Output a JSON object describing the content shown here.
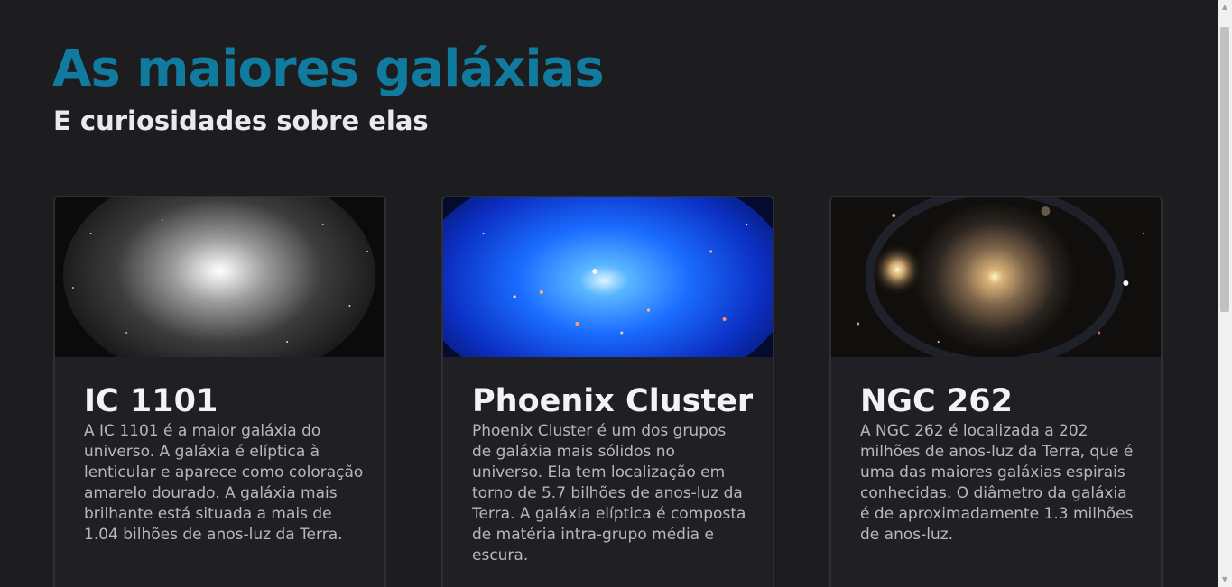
{
  "header": {
    "title": "As maiores galáxias",
    "subtitle": "E curiosidades sobre elas"
  },
  "cards": [
    {
      "title": "IC 1101",
      "text": "A IC 1101 é a maior galáxia do universo. A galáxia é elíptica à lenticular e aparece como coloração amarelo dourado. A galáxia mais brilhante está situada a mais de 1.04 bilhões de anos-luz da Terra."
    },
    {
      "title": "Phoenix Cluster",
      "text": "Phoenix Cluster é um dos grupos de galáxia mais sólidos no universo. Ela tem localização em torno de 5.7 bilhões de anos-luz da Terra. A galáxia elíptica é composta de matéria intra-grupo média e escura."
    },
    {
      "title": "NGC 262",
      "text": "A NGC 262 é localizada a 202 milhões de anos-luz da Terra, que é uma das maiores galáxias espirais conhecidas. O diâmetro da galáxia é de aproximadamente 1.3 milhões de anos-luz."
    }
  ],
  "colors": {
    "background": "#1d1d1f",
    "title": "#117a9f",
    "card": "#202024"
  },
  "icons": {
    "scroll_up": "triangle-up-icon",
    "scroll_down": "triangle-down-icon"
  }
}
